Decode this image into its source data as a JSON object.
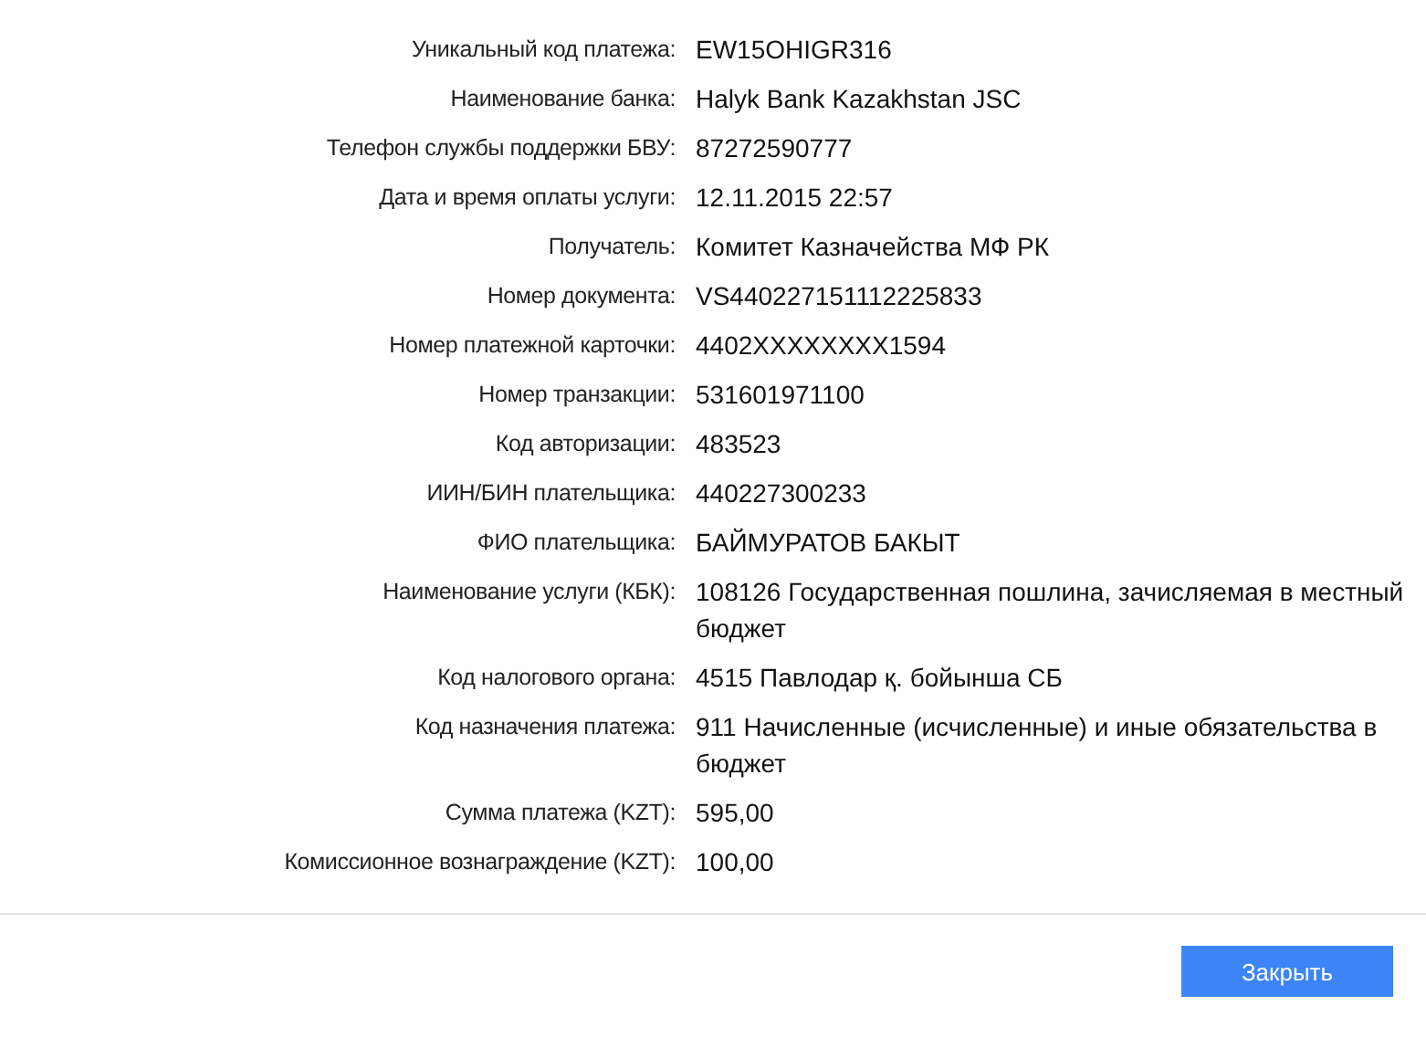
{
  "fields": [
    {
      "label": "Уникальный код платежа:",
      "value": "EW15OHIGR316"
    },
    {
      "label": "Наименование банка:",
      "value": "Halyk Bank Kazakhstan JSC"
    },
    {
      "label": "Телефон службы поддержки БВУ:",
      "value": "87272590777"
    },
    {
      "label": "Дата и время оплаты услуги:",
      "value": "12.11.2015 22:57"
    },
    {
      "label": "Получатель:",
      "value": "Комитет Казначейства МФ РК"
    },
    {
      "label": "Номер документа:",
      "value": "VS440227151112225833"
    },
    {
      "label": "Номер платежной карточки:",
      "value": "4402XXXXXXXX1594"
    },
    {
      "label": "Номер транзакции:",
      "value": "531601971100"
    },
    {
      "label": "Код авторизации:",
      "value": "483523"
    },
    {
      "label": "ИИН/БИН плательщика:",
      "value": "440227300233"
    },
    {
      "label": "ФИО плательщика:",
      "value": "БАЙМУРАТОВ БАКЫТ"
    },
    {
      "label": "Наименование услуги (КБК):",
      "value": "108126 Государственная пошлина, зачисляемая в местный бюджет"
    },
    {
      "label": "Код налогового органа:",
      "value": "4515 Павлодар қ. бойынша СБ"
    },
    {
      "label": "Код назначения платежа:",
      "value": "911 Начисленные (исчисленные) и иные обязательства в бюджет"
    },
    {
      "label": "Сумма платежа (KZT):",
      "value": "595,00"
    },
    {
      "label": "Комиссионное вознаграждение (KZT):",
      "value": "100,00"
    }
  ],
  "close_button": "Закрыть"
}
